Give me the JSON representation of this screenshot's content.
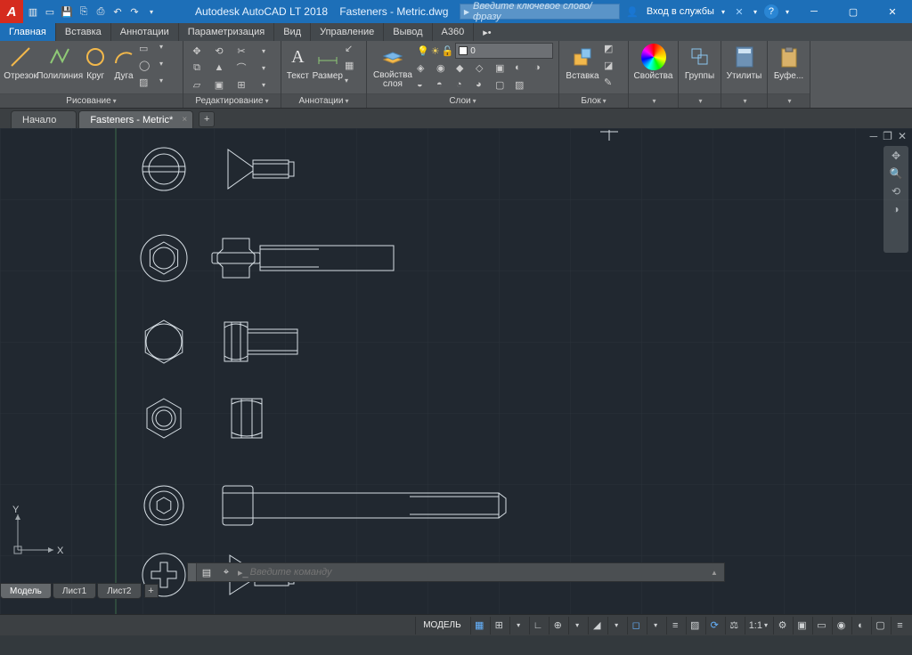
{
  "titlebar": {
    "app": "Autodesk AutoCAD LT 2018",
    "doc": "Fasteners - Metric.dwg",
    "search_placeholder": "Введите ключевое слово/фразу",
    "signin": "Вход в службы"
  },
  "menus": [
    "Главная",
    "Вставка",
    "Аннотации",
    "Параметризация",
    "Вид",
    "Управление",
    "Вывод",
    "A360"
  ],
  "ribbon": {
    "draw": {
      "caption": "Рисование",
      "line": "Отрезок",
      "pline": "Полилиния",
      "circle": "Круг",
      "arc": "Дуга"
    },
    "modify": {
      "caption": "Редактирование"
    },
    "annot": {
      "caption": "Аннотации",
      "text": "Текст",
      "dim": "Размер"
    },
    "layers": {
      "caption": "Слои",
      "props": "Свойства\nслоя",
      "current": "0"
    },
    "block": {
      "caption": "Блок",
      "insert": "Вставка"
    },
    "props": {
      "caption": "",
      "btn": "Свойства"
    },
    "groups": {
      "caption": "",
      "btn": "Группы"
    },
    "utils": {
      "caption": "",
      "btn": "Утилиты"
    },
    "clip": {
      "caption": "",
      "btn": "Буфе..."
    }
  },
  "doctabs": {
    "start": "Начало",
    "active": "Fasteners - Metric*"
  },
  "cmd": {
    "placeholder": "Введите команду"
  },
  "layouts": [
    "Модель",
    "Лист1",
    "Лист2"
  ],
  "status": {
    "model": "МОДЕЛЬ",
    "scale": "1:1"
  },
  "ucs": {
    "x": "X",
    "y": "Y"
  }
}
